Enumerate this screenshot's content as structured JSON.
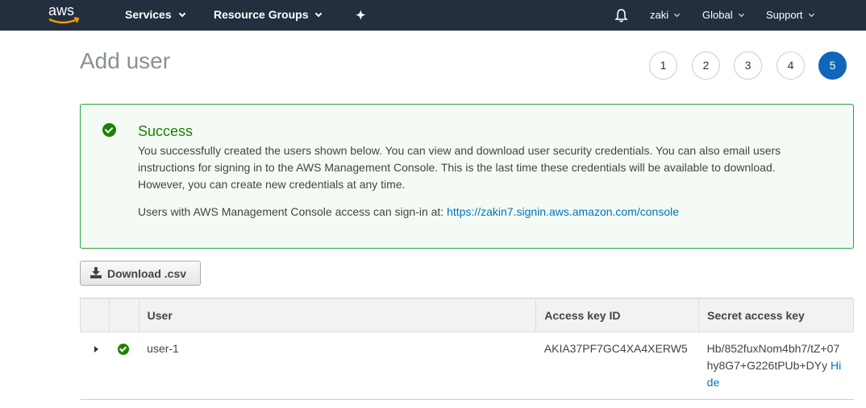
{
  "nav": {
    "logo": "aws",
    "services": "Services",
    "resource_groups": "Resource Groups",
    "user": "zaki",
    "region": "Global",
    "support": "Support"
  },
  "page": {
    "title": "Add user",
    "steps": [
      "1",
      "2",
      "3",
      "4",
      "5"
    ],
    "active_step": 5
  },
  "alert": {
    "title": "Success",
    "body": "You successfully created the users shown below. You can view and download user security credentials. You can also email users instructions for signing in to the AWS Management Console. This is the last time these credentials will be available to download. However, you can create new credentials at any time.",
    "signin_text": "Users with AWS Management Console access can sign-in at: ",
    "signin_url": "https://zakin7.signin.aws.amazon.com/console"
  },
  "download_label": "Download .csv",
  "table": {
    "headers": [
      "User",
      "Access key ID",
      "Secret access key"
    ],
    "rows": [
      {
        "user": "user-1",
        "access_key": "AKIA37PF7GC4XA4XERW5",
        "secret": "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",
        "hide": "Hide"
      }
    ]
  },
  "colors": {
    "nav_bg": "#232f3e",
    "success": "#1d8102",
    "link": "#0073bb",
    "active_step": "#1166bb"
  }
}
